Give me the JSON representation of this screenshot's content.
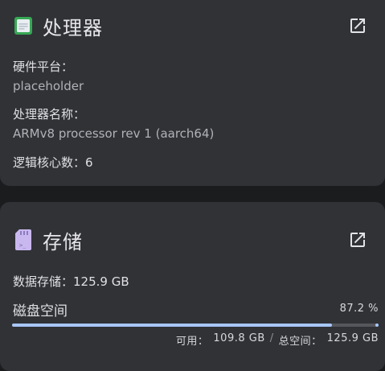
{
  "cpu": {
    "title": "处理器",
    "icon": "cpu-chip-icon",
    "platform_label": "硬件平台：",
    "platform_value": "placeholder",
    "name_label": "处理器名称：",
    "name_value": "ARMv8 processor rev 1 (aarch64)",
    "cores_text": "逻辑核心数：6"
  },
  "storage": {
    "title": "存储",
    "icon": "sd-card-icon",
    "data_storage_text": "数据存储：125.9 GB",
    "disk_label": "磁盘空间",
    "disk_percent_text": "87.2 %",
    "disk_used_fraction": 0.872,
    "available_label": "可用：",
    "available_value": "109.8 GB",
    "separator": "/",
    "total_label": "总空间：",
    "total_value": "125.9 GB"
  },
  "colors": {
    "background": "#1b1c1e",
    "card": "#303236",
    "accent": "#a8c7fa",
    "cpu_icon_green": "#35a853",
    "sd_icon_purple": "#c9b8f0"
  }
}
